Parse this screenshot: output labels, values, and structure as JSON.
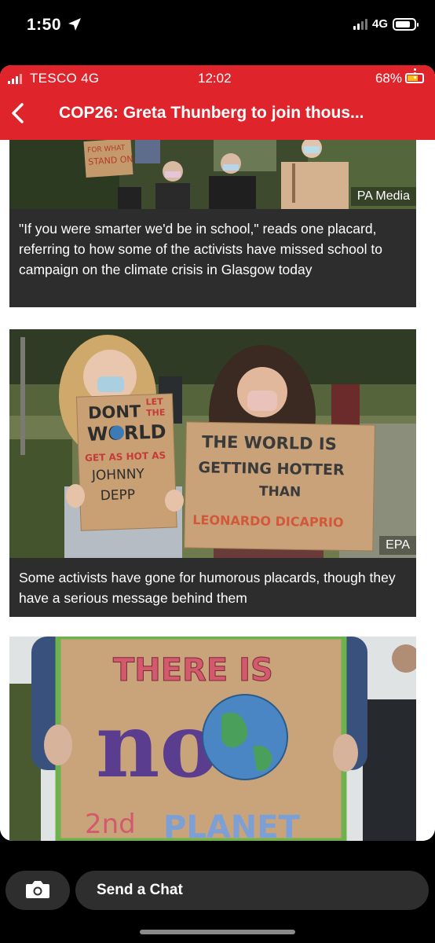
{
  "phone_status": {
    "time": "1:50",
    "network": "4G"
  },
  "inner_status": {
    "carrier": "TESCO  4G",
    "time": "12:02",
    "battery": "68%"
  },
  "article": {
    "headline": "COP26: Greta Thunberg to join thous..."
  },
  "items": [
    {
      "credit": "PA Media",
      "placard": [
        "FOR WHAT",
        "STAND ON"
      ],
      "caption": "\"If you were smarter we'd be in school,\" reads one placard, referring to how some of the activists have missed school to campaign on the climate crisis in Glasgow today"
    },
    {
      "credit": "EPA",
      "placard_left": [
        "DONT",
        "LET",
        "THE",
        "WORLD",
        "GET AS HOT AS",
        "JOHNNY",
        "DEPP"
      ],
      "placard_right": [
        "THE WORLD IS",
        "GETTING HOTTER",
        "THAN",
        "LEONARDO DICAPRIO"
      ],
      "caption": "Some activists have gone for humorous placards, though they have a serious message behind them"
    },
    {
      "placard": [
        "THERE IS",
        "no",
        "2nd",
        "PLANET"
      ]
    }
  ],
  "chat": {
    "placeholder": "Send a Chat"
  },
  "colors": {
    "bbc_red": "#e0242c",
    "caption_bg": "#2d2d2d",
    "chat_bg": "#2e2e2e"
  }
}
